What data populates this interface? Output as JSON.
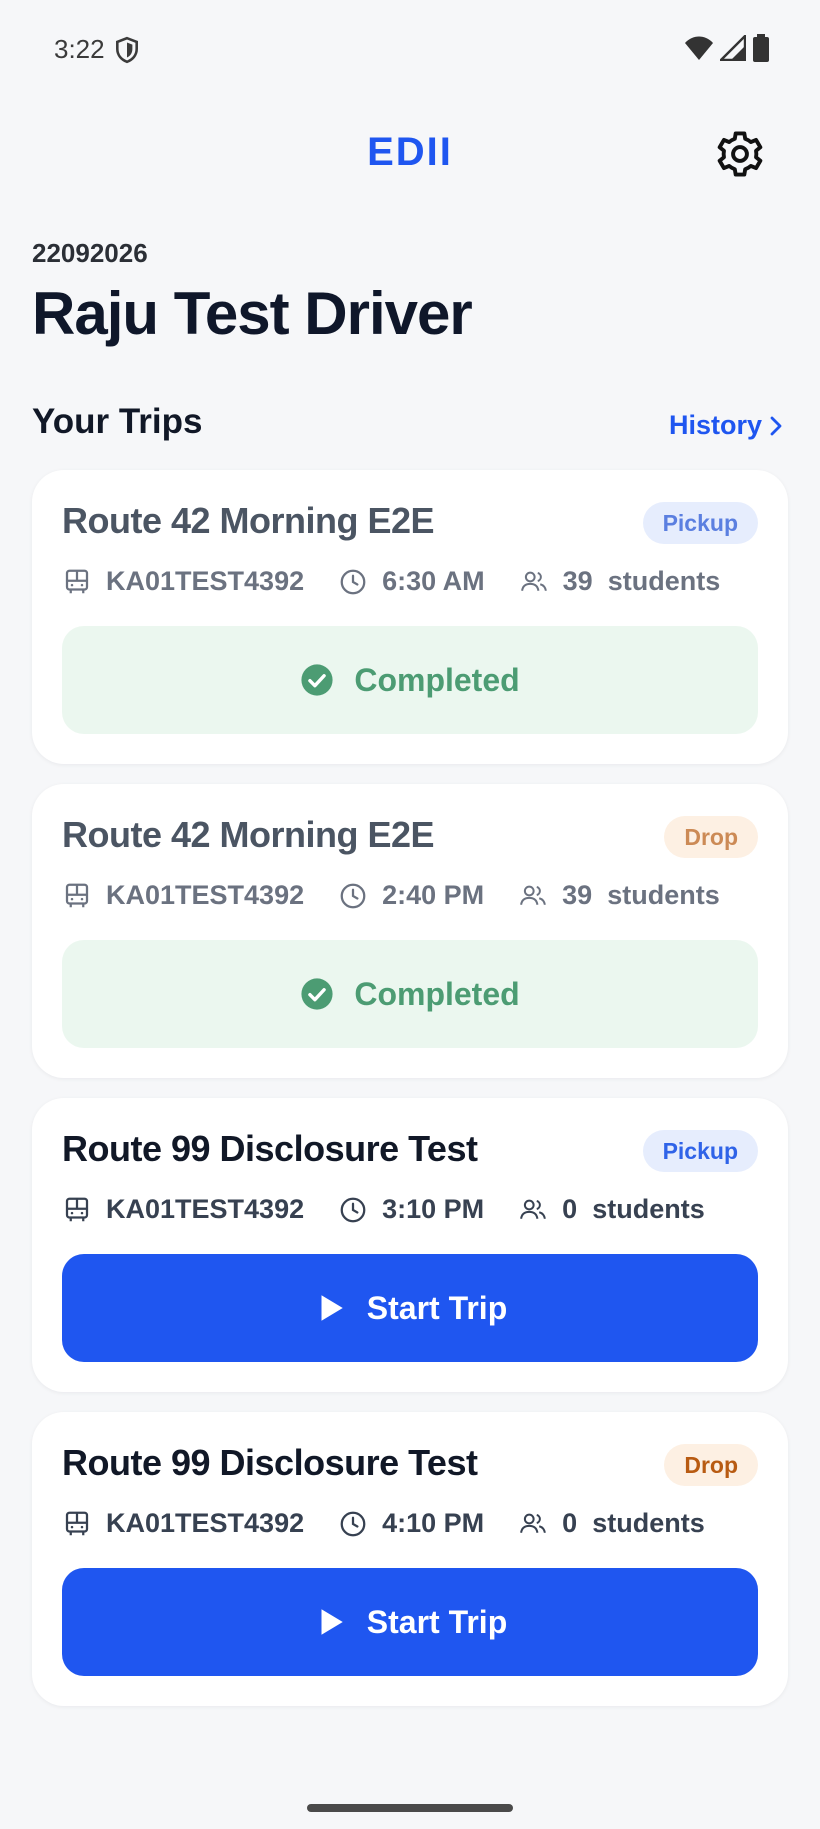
{
  "status_bar": {
    "time": "3:22"
  },
  "header": {
    "app_title": "EDII"
  },
  "driver": {
    "id": "22092026",
    "name": "Raju Test Driver"
  },
  "trips_section": {
    "title": "Your Trips",
    "history_label": "History"
  },
  "trips": [
    {
      "route": "Route 42 Morning E2E",
      "type": "Pickup",
      "vehicle": "KA01TEST4392",
      "time": "6:30 AM",
      "students": "39",
      "students_label": "students",
      "status": "Completed"
    },
    {
      "route": "Route 42 Morning E2E",
      "type": "Drop",
      "vehicle": "KA01TEST4392",
      "time": "2:40 PM",
      "students": "39",
      "students_label": "students",
      "status": "Completed"
    },
    {
      "route": "Route 99 Disclosure Test",
      "type": "Pickup",
      "vehicle": "KA01TEST4392",
      "time": "3:10 PM",
      "students": "0",
      "students_label": "students",
      "action": "Start Trip"
    },
    {
      "route": "Route 99 Disclosure Test",
      "type": "Drop",
      "vehicle": "KA01TEST4392",
      "time": "4:10 PM",
      "students": "0",
      "students_label": "students",
      "action": "Start Trip"
    }
  ],
  "colors": {
    "accent": "#1f56f0",
    "completed_bg": "#ebf7ef",
    "completed_text": "#4c9c73",
    "pickup_bg": "#e6edfd",
    "drop_bg": "#fdf0e3"
  },
  "icons": {
    "status_shield": "shield-icon",
    "wifi": "wifi-icon",
    "signal": "signal-icon",
    "battery": "battery-icon",
    "settings": "gear-icon",
    "history_chevron": "chevron-right-icon",
    "vehicle": "bus-icon",
    "time": "clock-icon",
    "students": "people-icon",
    "completed": "check-circle-icon",
    "start": "play-icon"
  }
}
